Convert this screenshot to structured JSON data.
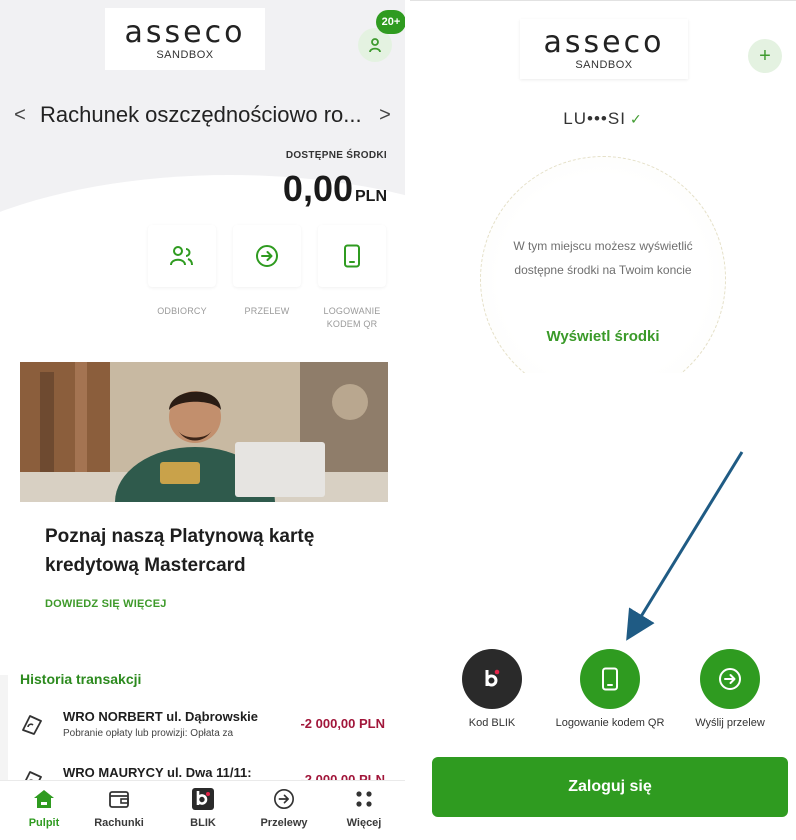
{
  "left_screen": {
    "logo": {
      "word": "asseco",
      "sub": "SANDBOX"
    },
    "notification_badge": "20+",
    "account": {
      "name": "Rachunek oszczędnościowo ro...",
      "prev": "<",
      "next": ">",
      "available_label": "DOSTĘPNE ŚRODKI",
      "amount": "0,00",
      "currency": "PLN"
    },
    "quick_actions": [
      {
        "label": "ODBIORCY",
        "icon": "recipients-icon"
      },
      {
        "label": "PRZELEW",
        "icon": "transfer-arrow-icon"
      },
      {
        "label": "LOGOWANIE KODEM QR",
        "icon": "phone-icon"
      }
    ],
    "promo": {
      "title": "Poznaj naszą Platynową kartę kredytową Mastercard",
      "link": "DOWIEDZ SIĘ WIĘCEJ"
    },
    "history": {
      "title": "Historia transakcji",
      "items": [
        {
          "name": "WRO NORBERT ul. Dąbrowskie",
          "desc": "Pobranie opłaty lub prowizji: Opłata za",
          "amount": "-2 000,00 PLN"
        },
        {
          "name": "WRO MAURYCY ul. Dwa 11/11:",
          "desc": "",
          "amount": "-2 000,00 PLN"
        }
      ]
    },
    "tabs": [
      {
        "label": "Pulpit",
        "icon": "home-icon",
        "active": true
      },
      {
        "label": "Rachunki",
        "icon": "wallet-icon",
        "active": false
      },
      {
        "label": "BLIK",
        "icon": "blik-icon",
        "active": false
      },
      {
        "label": "Przelewy",
        "icon": "transfer-arrow-icon",
        "active": false
      },
      {
        "label": "Więcej",
        "icon": "more-dots-icon",
        "active": false
      }
    ]
  },
  "right_screen": {
    "logo": {
      "word": "asseco",
      "sub": "SANDBOX"
    },
    "plus": "+",
    "user_login": "LU•••SI",
    "dropdown_glyph": "⌄",
    "balance_hint": "W tym miejscu możesz wyświetlić dostępne środki na Twoim koncie",
    "show_funds_link": "Wyświetl środki",
    "quick_buttons": [
      {
        "label": "Kod BLIK",
        "icon": "blik-icon",
        "color": "#2a2a2a"
      },
      {
        "label": "Logowanie kodem QR",
        "icon": "phone-icon",
        "color": "#2f9b20"
      },
      {
        "label": "Wyślij przelew",
        "icon": "transfer-arrow-icon",
        "color": "#2f9b20"
      }
    ],
    "login_button": "Zaloguj się"
  },
  "colors": {
    "brand_green": "#2f9b20",
    "debit_red": "#a1163a",
    "annotation_arrow": "#1f5b84"
  }
}
